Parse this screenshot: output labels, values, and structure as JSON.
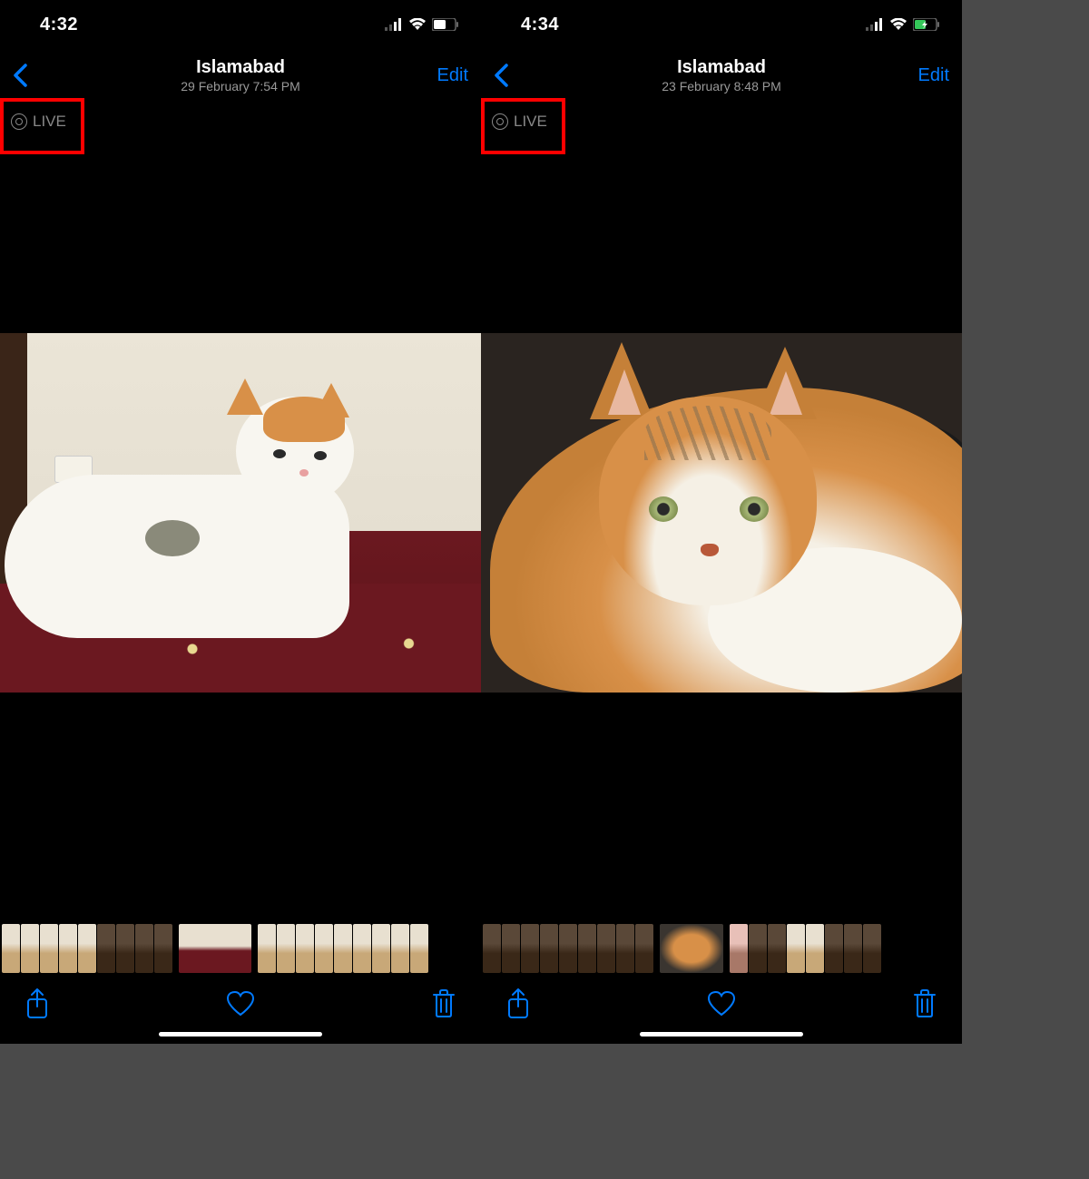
{
  "annotation": {
    "highlight_target": "live-photo-badge",
    "highlight_color": "#ff0000"
  },
  "screens": [
    {
      "status": {
        "time": "4:32",
        "battery_charging": false
      },
      "nav": {
        "title": "Islamabad",
        "subtitle": "29 February  7:54 PM",
        "edit_label": "Edit"
      },
      "live_badge": "LIVE",
      "photo_description": "White cat with orange head markings lying on a red patterned carpet",
      "toolbar": {
        "share": "share-icon",
        "favorite": "heart-icon",
        "delete": "trash-icon"
      }
    },
    {
      "status": {
        "time": "4:34",
        "battery_charging": true
      },
      "nav": {
        "title": "Islamabad",
        "subtitle": "23 February  8:48 PM",
        "edit_label": "Edit"
      },
      "live_badge": "LIVE",
      "photo_description": "Close-up of a calico cat with orange, grey and white fur",
      "toolbar": {
        "share": "share-icon",
        "favorite": "heart-icon",
        "delete": "trash-icon"
      }
    }
  ]
}
